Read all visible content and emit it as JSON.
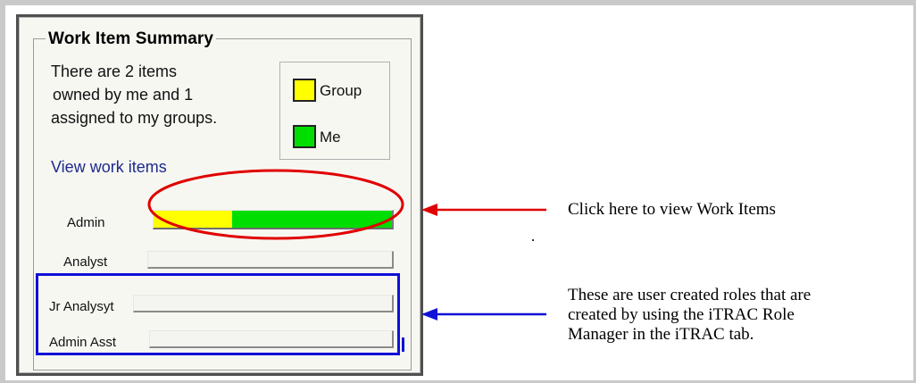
{
  "widget": {
    "title": "Work Item Summary",
    "summary_lines": [
      "There are 2 items",
      "owned by me and 1",
      "assigned to my groups."
    ],
    "legend": [
      {
        "label": "Group",
        "color": "#ffff00"
      },
      {
        "label": "Me",
        "color": "#00dd00"
      }
    ],
    "view_link": "View work items",
    "roles": [
      {
        "name": "Admin",
        "group_fraction": 0.33,
        "me_fraction": 0.67
      },
      {
        "name": "Analyst",
        "group_fraction": 0,
        "me_fraction": 0
      },
      {
        "name": "Jr Analysyt",
        "group_fraction": 0,
        "me_fraction": 0
      },
      {
        "name": "Admin Asst",
        "group_fraction": 0,
        "me_fraction": 0
      }
    ]
  },
  "annotations": {
    "red_callout": "Click here to view Work Items",
    "blue_callout_lines": [
      "These are user created roles that are",
      "created by using the iTRAC Role",
      "Manager in the iTRAC tab."
    ],
    "red_color": "#e00000",
    "blue_color": "#1010d8"
  }
}
